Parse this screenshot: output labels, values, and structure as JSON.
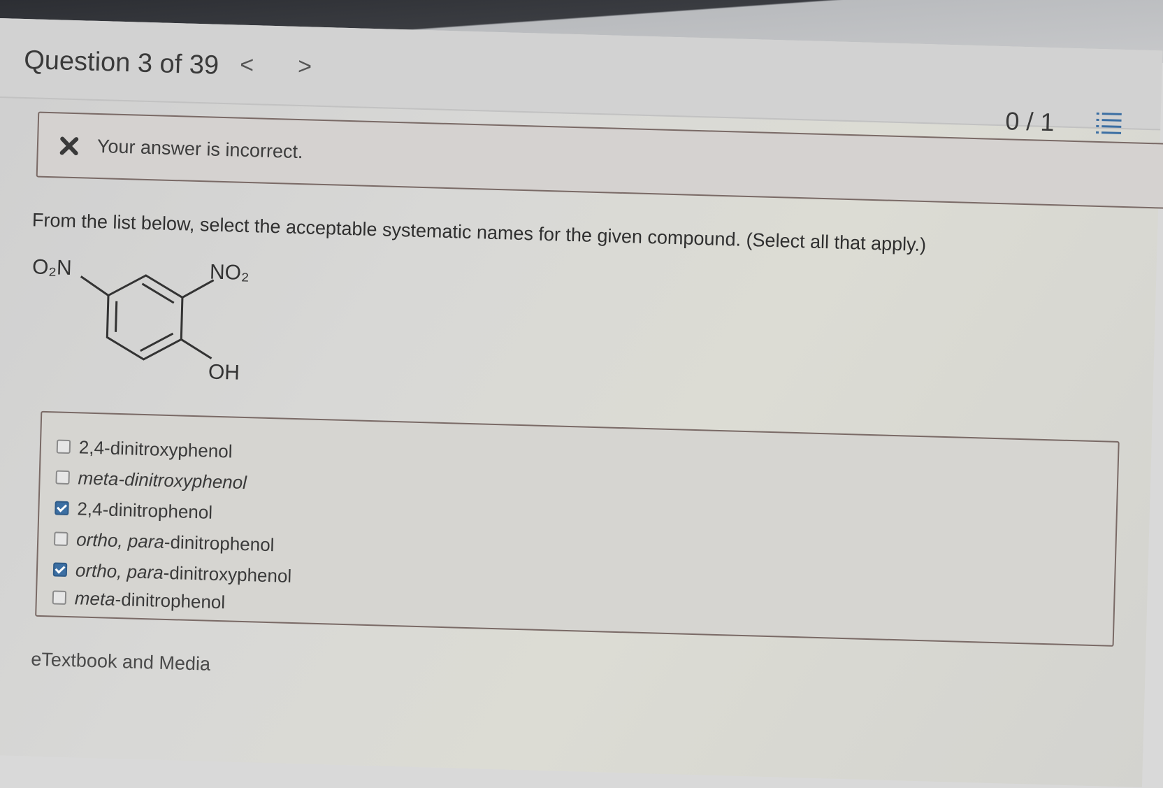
{
  "header": {
    "title": "Question 3 of 39",
    "prev_label": "<",
    "next_label": ">",
    "score": "0 / 1",
    "list_icon": "list-icon"
  },
  "feedback": {
    "icon": "x-icon",
    "text": "Your answer is incorrect."
  },
  "prompt": "From the list below, select the acceptable systematic names for the given compound. (Select all that apply.)",
  "structure": {
    "labels": [
      "O₂N",
      "NO₂",
      "OH"
    ]
  },
  "options": [
    {
      "prefix": "",
      "text": "2,4-dinitroxyphenol",
      "checked": false
    },
    {
      "prefix": "meta",
      "text": "-dinitroxyphenol",
      "checked": false
    },
    {
      "prefix": "",
      "text": "2,4-dinitrophenol",
      "checked": true
    },
    {
      "prefix": "ortho, para",
      "text": "-dinitrophenol",
      "checked": false
    },
    {
      "prefix": "ortho, para",
      "text": "-dinitroxyphenol",
      "checked": true
    },
    {
      "prefix": "meta",
      "text": "-dinitrophenol",
      "checked": false
    }
  ],
  "etextbook": "eTextbook and Media",
  "colors": {
    "incorrect": "#3a3a3a",
    "checkbox_checked": "#3c6fa3",
    "border": "#7a6a66"
  }
}
